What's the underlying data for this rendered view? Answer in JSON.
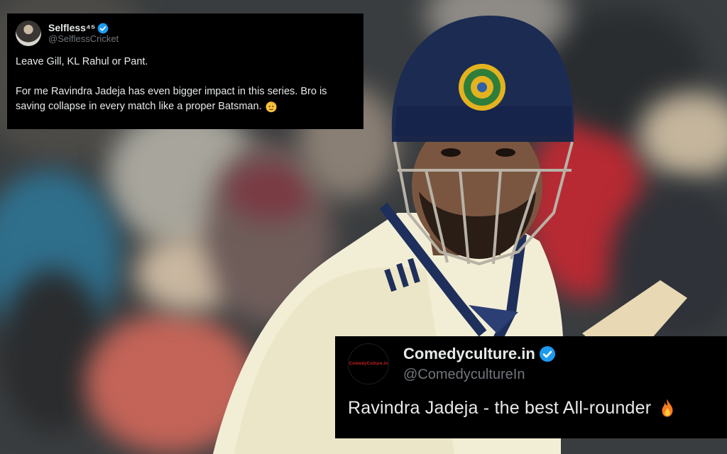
{
  "tweet_top": {
    "display_name": "Selfless⁴⁵",
    "handle": "@SelflessCricket",
    "line1": "Leave Gill, KL Rahul or Pant.",
    "line2": "For me Ravindra Jadeja has even bigger impact in this series. Bro is saving collapse in every match like a proper Batsman.",
    "emoji": "saluting-face-icon"
  },
  "tweet_bottom": {
    "display_name": "Comedyculture.in",
    "handle": "@ComedycultureIn",
    "avatar_text": "ComedyCulture.in",
    "text": "Ravindra Jadeja - the best All-rounder",
    "emoji": "fire-icon"
  },
  "colors": {
    "card_bg": "#000000",
    "name_text": "#e7e9ea",
    "handle_text": "#71767b",
    "verified_blue": "#1d9bf0",
    "helmet_navy": "#1c2b52"
  }
}
